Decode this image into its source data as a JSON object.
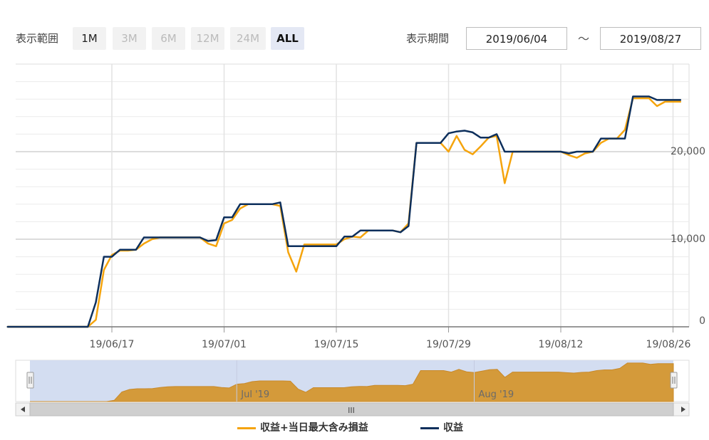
{
  "controls": {
    "range_label": "表示範囲",
    "range_buttons": [
      {
        "label": "1M",
        "enabled": true,
        "selected": false
      },
      {
        "label": "3M",
        "enabled": false,
        "selected": false
      },
      {
        "label": "6M",
        "enabled": false,
        "selected": false
      },
      {
        "label": "12M",
        "enabled": false,
        "selected": false
      },
      {
        "label": "24M",
        "enabled": false,
        "selected": false
      },
      {
        "label": "ALL",
        "enabled": true,
        "selected": true
      }
    ],
    "period_label": "表示期間",
    "date_from": "2019/06/04",
    "separator": "～",
    "date_to": "2019/08/27"
  },
  "colors": {
    "profit_incl_loss": "#f5a40d",
    "profit": "#0d2f5c",
    "navigator_fill": "#d49a3a",
    "navigator_mask": "#d3ddf1"
  },
  "chart_data": {
    "type": "line",
    "x_range": [
      "2019-06-04",
      "2019-08-27"
    ],
    "y_range": [
      0,
      30000
    ],
    "y_ticks": [
      "0",
      "10,000",
      "20,000"
    ],
    "x_ticks": [
      "19/06/17",
      "19/07/01",
      "19/07/15",
      "19/07/29",
      "19/08/12",
      "19/08/26"
    ],
    "grid": true,
    "legend_position": "bottom",
    "series": [
      {
        "name": "収益+当日最大含み損益",
        "x": [
          "2019-06-04",
          "2019-06-14",
          "2019-06-15",
          "2019-06-16",
          "2019-06-17",
          "2019-06-18",
          "2019-06-19",
          "2019-06-20",
          "2019-06-21",
          "2019-06-22",
          "2019-06-23",
          "2019-06-24",
          "2019-06-25",
          "2019-06-26",
          "2019-06-27",
          "2019-06-28",
          "2019-06-29",
          "2019-06-30",
          "2019-07-01",
          "2019-07-02",
          "2019-07-03",
          "2019-07-04",
          "2019-07-05",
          "2019-07-06",
          "2019-07-07",
          "2019-07-08",
          "2019-07-09",
          "2019-07-10",
          "2019-07-11",
          "2019-07-12",
          "2019-07-13",
          "2019-07-14",
          "2019-07-15",
          "2019-07-16",
          "2019-07-17",
          "2019-07-18",
          "2019-07-19",
          "2019-07-20",
          "2019-07-21",
          "2019-07-22",
          "2019-07-23",
          "2019-07-24",
          "2019-07-25",
          "2019-07-26",
          "2019-07-27",
          "2019-07-28",
          "2019-07-29",
          "2019-07-30",
          "2019-07-31",
          "2019-08-01",
          "2019-08-02",
          "2019-08-03",
          "2019-08-04",
          "2019-08-05",
          "2019-08-06",
          "2019-08-07",
          "2019-08-08",
          "2019-08-09",
          "2019-08-10",
          "2019-08-11",
          "2019-08-12",
          "2019-08-13",
          "2019-08-14",
          "2019-08-15",
          "2019-08-16",
          "2019-08-17",
          "2019-08-18",
          "2019-08-19",
          "2019-08-20",
          "2019-08-21",
          "2019-08-22",
          "2019-08-23",
          "2019-08-24",
          "2019-08-25",
          "2019-08-26",
          "2019-08-27"
        ],
        "y": [
          0,
          0,
          800,
          6500,
          8200,
          8700,
          8700,
          8800,
          9500,
          10000,
          10200,
          10200,
          10200,
          10200,
          10200,
          10200,
          9500,
          9200,
          11800,
          12200,
          13500,
          14000,
          14000,
          14000,
          14000,
          13800,
          8500,
          6300,
          9400,
          9400,
          9400,
          9400,
          9400,
          10000,
          10300,
          10200,
          11000,
          11000,
          11000,
          11000,
          10800,
          11800,
          21000,
          21000,
          21000,
          21000,
          20000,
          21800,
          20200,
          19700,
          20600,
          21600,
          21800,
          16400,
          20000,
          20000,
          20000,
          20000,
          20000,
          20000,
          20000,
          19600,
          19300,
          19800,
          20000,
          21000,
          21500,
          21500,
          22500,
          26100,
          26100,
          26100,
          25200,
          25700,
          25700,
          25700
        ]
      },
      {
        "name": "収益",
        "x": [
          "2019-06-04",
          "2019-06-14",
          "2019-06-15",
          "2019-06-16",
          "2019-06-17",
          "2019-06-18",
          "2019-06-19",
          "2019-06-20",
          "2019-06-21",
          "2019-06-22",
          "2019-06-23",
          "2019-06-24",
          "2019-06-25",
          "2019-06-26",
          "2019-06-27",
          "2019-06-28",
          "2019-06-29",
          "2019-06-30",
          "2019-07-01",
          "2019-07-02",
          "2019-07-03",
          "2019-07-04",
          "2019-07-05",
          "2019-07-06",
          "2019-07-07",
          "2019-07-08",
          "2019-07-09",
          "2019-07-10",
          "2019-07-11",
          "2019-07-12",
          "2019-07-13",
          "2019-07-14",
          "2019-07-15",
          "2019-07-16",
          "2019-07-17",
          "2019-07-18",
          "2019-07-19",
          "2019-07-20",
          "2019-07-21",
          "2019-07-22",
          "2019-07-23",
          "2019-07-24",
          "2019-07-25",
          "2019-07-26",
          "2019-07-27",
          "2019-07-28",
          "2019-07-29",
          "2019-07-30",
          "2019-07-31",
          "2019-08-01",
          "2019-08-02",
          "2019-08-03",
          "2019-08-04",
          "2019-08-05",
          "2019-08-06",
          "2019-08-07",
          "2019-08-08",
          "2019-08-09",
          "2019-08-10",
          "2019-08-11",
          "2019-08-12",
          "2019-08-13",
          "2019-08-14",
          "2019-08-15",
          "2019-08-16",
          "2019-08-17",
          "2019-08-18",
          "2019-08-19",
          "2019-08-20",
          "2019-08-21",
          "2019-08-22",
          "2019-08-23",
          "2019-08-24",
          "2019-08-25",
          "2019-08-26",
          "2019-08-27"
        ],
        "y": [
          0,
          0,
          2800,
          8000,
          8000,
          8800,
          8800,
          8800,
          10200,
          10200,
          10200,
          10200,
          10200,
          10200,
          10200,
          10200,
          9800,
          9900,
          12500,
          12500,
          14000,
          14000,
          14000,
          14000,
          14000,
          14200,
          9200,
          9200,
          9200,
          9200,
          9200,
          9200,
          9200,
          10300,
          10300,
          11000,
          11000,
          11000,
          11000,
          11000,
          10800,
          11500,
          21000,
          21000,
          21000,
          21000,
          22100,
          22300,
          22400,
          22200,
          21600,
          21600,
          22000,
          20000,
          20000,
          20000,
          20000,
          20000,
          20000,
          20000,
          20000,
          19800,
          20000,
          20000,
          20000,
          21500,
          21500,
          21500,
          21500,
          26300,
          26300,
          26300,
          25900,
          25900,
          25900,
          25900
        ]
      }
    ],
    "navigator_ticks": [
      "Jul '19",
      "Aug '19"
    ]
  },
  "navigator": {
    "scroll_grip": "III"
  }
}
